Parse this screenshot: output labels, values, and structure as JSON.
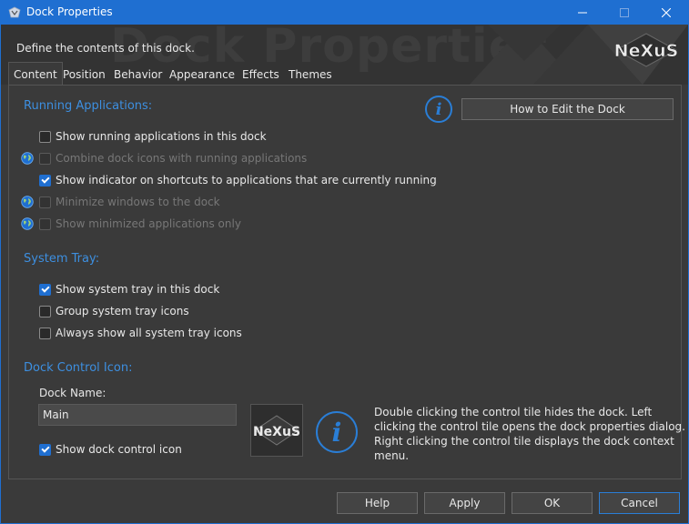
{
  "window": {
    "title": "Dock Properties"
  },
  "header": {
    "description": "Define the contents of this dock.",
    "watermark": "Dock Properties",
    "logo": "NeXuS"
  },
  "tabs": [
    {
      "label": "Content",
      "active": true
    },
    {
      "label": "Position"
    },
    {
      "label": "Behavior"
    },
    {
      "label": "Appearance"
    },
    {
      "label": "Effects"
    },
    {
      "label": "Themes"
    }
  ],
  "running_apps": {
    "title": "Running Applications:",
    "help_button": "How to Edit the Dock",
    "options": [
      {
        "label": "Show running applications in this dock",
        "checked": false,
        "disabled": false,
        "globe": false
      },
      {
        "label": "Combine dock icons with running applications",
        "checked": false,
        "disabled": true,
        "globe": true
      },
      {
        "label": "Show indicator on shortcuts to applications that are currently running",
        "checked": true,
        "disabled": false,
        "globe": false
      },
      {
        "label": "Minimize windows to the dock",
        "checked": false,
        "disabled": true,
        "globe": true
      },
      {
        "label": "Show minimized applications only",
        "checked": false,
        "disabled": true,
        "globe": true
      }
    ]
  },
  "system_tray": {
    "title": "System Tray:",
    "options": [
      {
        "label": "Show system tray in this dock",
        "checked": true
      },
      {
        "label": "Group system tray icons",
        "checked": false
      },
      {
        "label": "Always show all system tray icons",
        "checked": false
      }
    ]
  },
  "dock_control": {
    "title": "Dock Control Icon:",
    "name_label": "Dock Name:",
    "name_value": "Main",
    "show_icon_label": "Show dock control icon",
    "show_icon_checked": true,
    "tile_logo": "NeXuS",
    "description_lines": [
      "Double clicking the control tile hides the dock. Left",
      "clicking the control tile opens the dock properties dialog.",
      "Right clicking the control tile displays the dock context",
      "menu."
    ]
  },
  "footer": {
    "help": "Help",
    "apply": "Apply",
    "ok": "OK",
    "cancel": "Cancel"
  },
  "colors": {
    "accent": "#1f6fd1",
    "section_title": "#3d8fe0",
    "background": "#3a3a3a"
  }
}
